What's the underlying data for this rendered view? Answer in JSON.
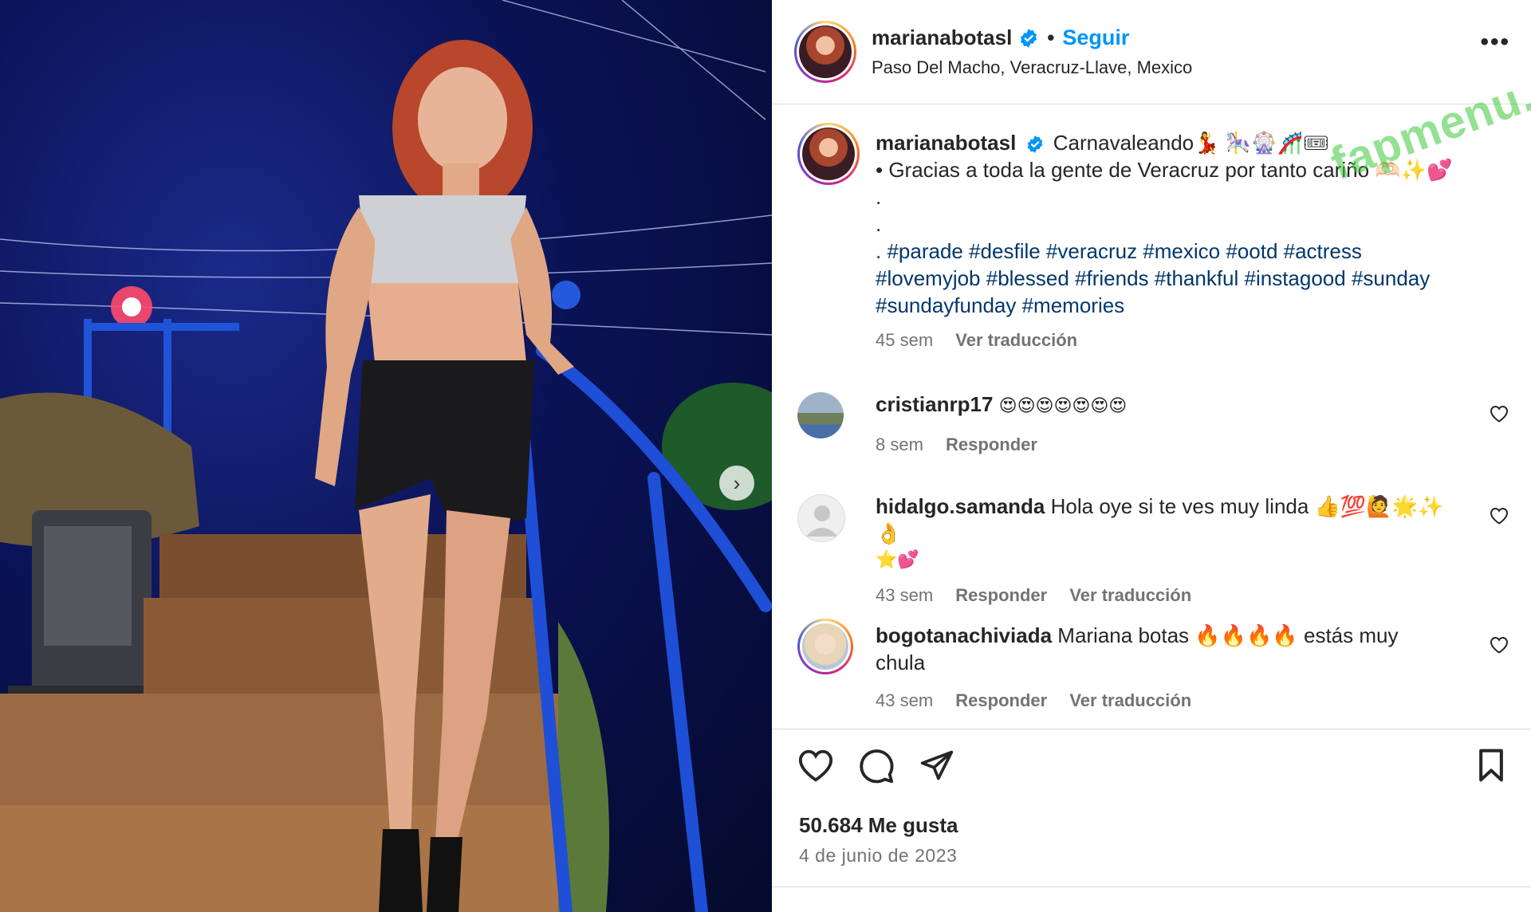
{
  "post": {
    "username": "marianabotasl",
    "follow_label": "Seguir",
    "separator": "•",
    "location": "Paso Del Macho, Veracruz-Llave, Mexico",
    "more_label": "•••"
  },
  "caption": {
    "username": "marianabotasl",
    "line1": "Carnavaleando💃 🎠🎡🎢🎟",
    "line2": "• Gracias a toda la gente de Veracruz por tanto cariño 🫶🏻✨💕",
    "dot1": ".",
    "dot2": ".",
    "hashtags_line1": ". #parade #desfile #veracruz #mexico #ootd #actress",
    "hashtags_line2": "#lovemyjob #blessed #friends #thankful #instagood #sunday",
    "hashtags_line3": "#sundayfunday #memories",
    "time": "45 sem",
    "translate_label": "Ver traducción"
  },
  "comments": [
    {
      "username": "cristianrp17",
      "text": "😍😍😍😍😍😍😍",
      "time": "8 sem",
      "reply_label": "Responder",
      "translate_label": ""
    },
    {
      "username": "hidalgo.samanda",
      "text": "Hola oye si te ves muy linda 👍💯🙋🌟✨👌",
      "text_line2": "⭐💕",
      "time": "43 sem",
      "reply_label": "Responder",
      "translate_label": "Ver traducción"
    },
    {
      "username": "bogotanachiviada",
      "text": "Mariana botas 🔥🔥🔥🔥 estás muy chula",
      "time": "43 sem",
      "reply_label": "Responder",
      "translate_label": "Ver traducción"
    }
  ],
  "footer": {
    "likes": "50.684 Me gusta",
    "date": "4 de junio de 2023"
  },
  "watermark": "fapmenu.com",
  "icons": [
    "heart-icon",
    "comment-icon",
    "share-icon",
    "bookmark-icon",
    "chevron-right-icon",
    "verified-badge-icon"
  ],
  "colors": {
    "link_blue": "#0095f6",
    "hashtag_blue": "#00376b",
    "muted": "#737373",
    "verified": "#0095f6"
  }
}
